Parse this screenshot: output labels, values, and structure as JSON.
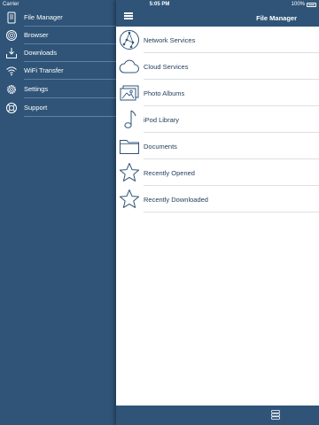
{
  "status": {
    "carrier": "Carrier",
    "time": "5:05 PM",
    "battery": "100%"
  },
  "sidebar": {
    "items": [
      {
        "label": "File Manager",
        "icon": "file-manager-icon"
      },
      {
        "label": "Browser",
        "icon": "compass-icon"
      },
      {
        "label": "Downloads",
        "icon": "download-tray-icon"
      },
      {
        "label": "WiFi Transfer",
        "icon": "wifi-icon"
      },
      {
        "label": "Settings",
        "icon": "gear-icon"
      },
      {
        "label": "Support",
        "icon": "lifebuoy-icon"
      }
    ]
  },
  "header": {
    "title": "File Manager",
    "menu_icon": "hamburger-menu-icon"
  },
  "list": {
    "items": [
      {
        "label": "Network Services",
        "icon": "network-icon"
      },
      {
        "label": "Cloud Services",
        "icon": "cloud-icon"
      },
      {
        "label": "Photo Albums",
        "icon": "photo-albums-icon"
      },
      {
        "label": "iPod Library",
        "icon": "music-note-icon"
      },
      {
        "label": "Documents",
        "icon": "folder-icon"
      },
      {
        "label": "Recently Opened",
        "icon": "star-icon"
      },
      {
        "label": "Recently Downloaded",
        "icon": "star-icon"
      }
    ]
  },
  "toolbar": {
    "icon": "database-stack-icon"
  },
  "colors": {
    "sidebar_bg": "#2f5478",
    "accent": "#2f5478",
    "text_dark": "#243f5c",
    "separator": "#dcdfe3"
  }
}
